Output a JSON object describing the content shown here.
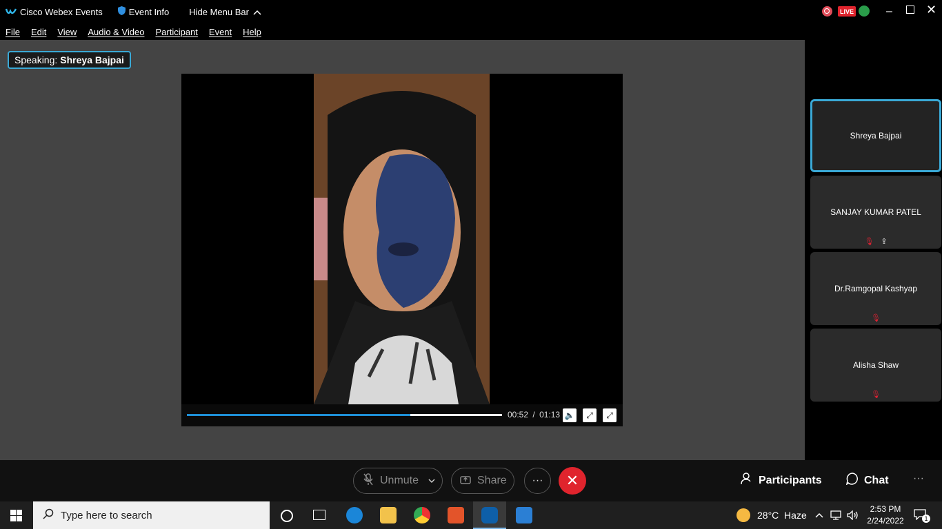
{
  "titlebar": {
    "app_title": "Cisco Webex Events",
    "event_info": "Event Info",
    "hide_menu": "Hide Menu Bar",
    "live_badge": "LIVE"
  },
  "menu": [
    "File",
    "Edit",
    "View",
    "Audio & Video",
    "Participant",
    "Event",
    "Help"
  ],
  "speaking": {
    "label": "Speaking:",
    "name": "Shreya Bajpai"
  },
  "video": {
    "current": "00:52",
    "total": "01:13",
    "separator": "/",
    "progress": 0.71
  },
  "participants": [
    {
      "name": "Shreya Bajpai",
      "active": true
    },
    {
      "name": "SANJAY KUMAR PATEL",
      "muted": true,
      "sharing": true
    },
    {
      "name": "Dr.Ramgopal Kashyap",
      "muted": true
    },
    {
      "name": "Alisha Shaw",
      "muted": true
    }
  ],
  "controls": {
    "unmute": "Unmute",
    "share": "Share",
    "more": "···",
    "participants": "Participants",
    "chat": "Chat",
    "overflow": "···"
  },
  "taskbar": {
    "search_placeholder": "Type here to search",
    "weather": "28°C  Haze",
    "time": "2:53 PM",
    "date": "2/24/2022",
    "notif_count": "1"
  },
  "colors": {
    "accent": "#3aa9d6",
    "end_call": "#e0242d",
    "progress": "#1e8fd6"
  }
}
